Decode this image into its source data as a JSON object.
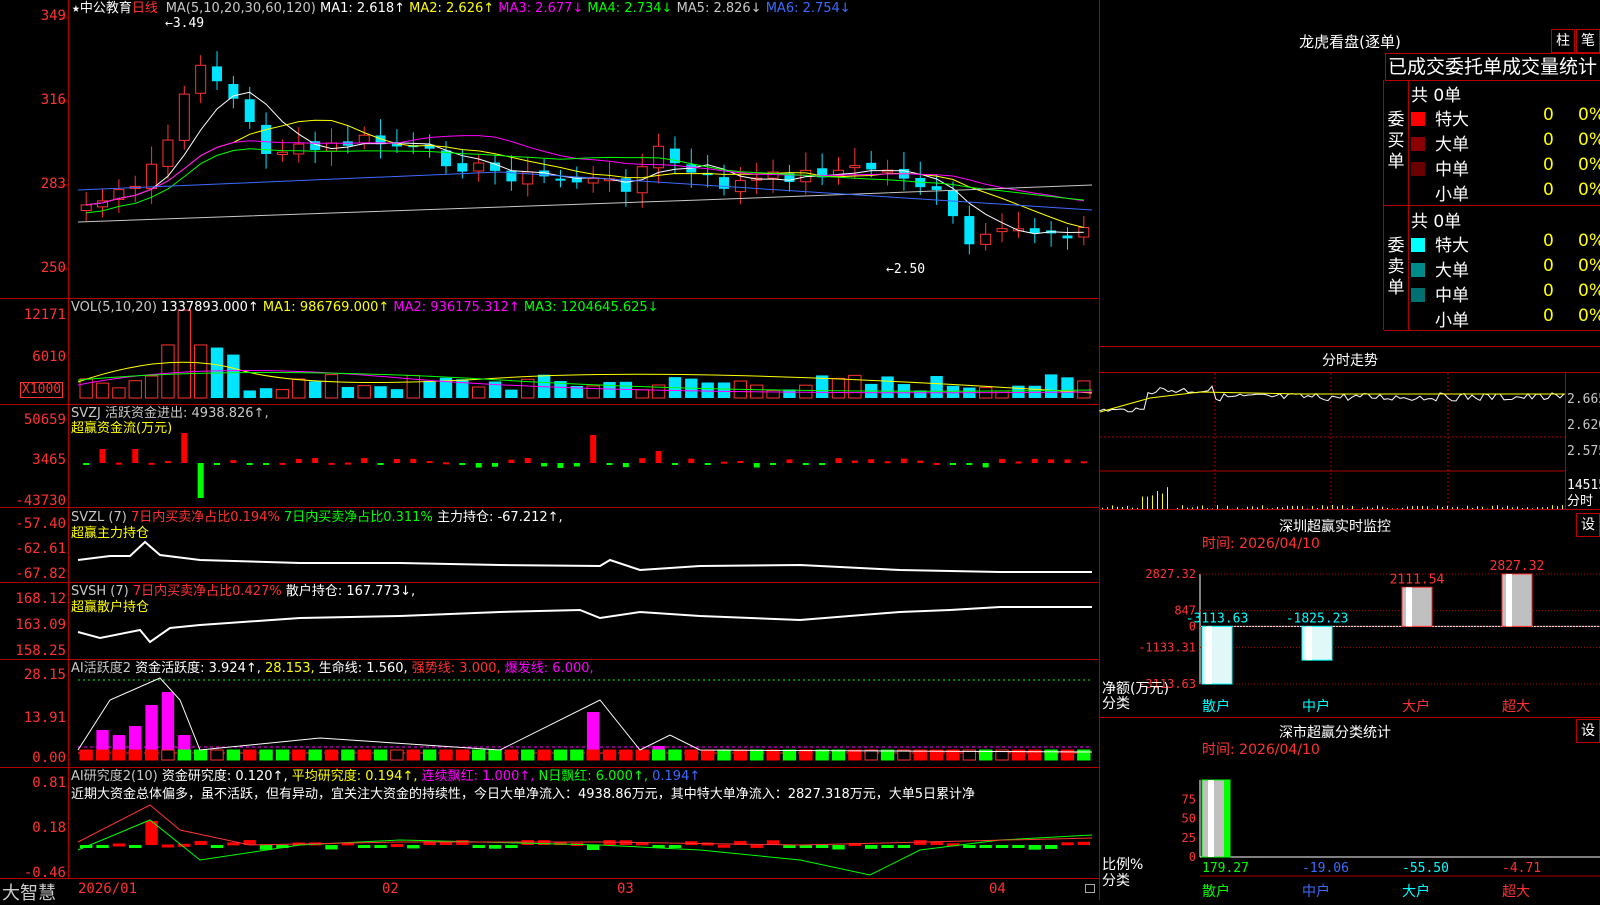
{
  "stock": {
    "name": "中公教育",
    "period": "日线",
    "star": "★"
  },
  "main_panel": {
    "ma_legend": [
      {
        "label": "MA(5,10,20,30,60,120)",
        "color": "#c8c8c8"
      },
      {
        "label": "MA1: 2.618↑",
        "color": "#ffffff"
      },
      {
        "label": "MA2: 2.626↑",
        "color": "#ffff00"
      },
      {
        "label": "MA3: 2.677↓",
        "color": "#ff00ff"
      },
      {
        "label": "MA4: 2.734↓",
        "color": "#00ff00"
      },
      {
        "label": "MA5: 2.826↓",
        "color": "#c8c8c8"
      },
      {
        "label": "MA6: 2.754↓",
        "color": "#3c6bff"
      }
    ],
    "y_ticks": [
      "349",
      "316",
      "283",
      "250"
    ],
    "high_marker": "←3.49",
    "low_marker": "←2.50"
  },
  "vol_panel": {
    "legend": [
      {
        "label": "VOL(5,10,20)",
        "color": "#c8c8c8"
      },
      {
        "label": "1337893.000↑",
        "color": "#ffffff"
      },
      {
        "label": "MA1: 986769.000↑",
        "color": "#ffff00"
      },
      {
        "label": "MA2: 936175.312↑",
        "color": "#ff00ff"
      },
      {
        "label": "MA3: 1204645.625↓",
        "color": "#00ff00"
      }
    ],
    "y_ticks": [
      "12171",
      "6010"
    ],
    "unit": "X1000"
  },
  "svzj_panel": {
    "legend": [
      {
        "label": "SVZJ  活跃资金进出: 4938.826↑,",
        "color": "#c8c8c8"
      }
    ],
    "subtitle": "超赢资金流(万元)",
    "y_ticks": [
      "50659",
      "3465",
      "-43730"
    ]
  },
  "svzl_panel": {
    "legend": [
      {
        "label": "SVZL (7)",
        "color": "#c8c8c8"
      },
      {
        "label": "7日内买卖净占比0.194%",
        "color": "#ff3232"
      },
      {
        "label": "7日内买卖净占比0.311%",
        "color": "#00ff00"
      },
      {
        "label": "主力持仓: -67.212↑,",
        "color": "#ffffff"
      }
    ],
    "subtitle": "超赢主力持仓",
    "y_ticks": [
      "-57.40",
      "-62.61",
      "-67.82"
    ]
  },
  "svsh_panel": {
    "legend": [
      {
        "label": "SVSH (7)",
        "color": "#c8c8c8"
      },
      {
        "label": "7日内买卖净占比0.427%",
        "color": "#ff3232"
      },
      {
        "label": "散户持仓: 167.773↓,",
        "color": "#ffffff"
      }
    ],
    "subtitle": "超赢散户持仓",
    "y_ticks": [
      "168.12",
      "163.09",
      "158.25"
    ]
  },
  "ai_active_panel": {
    "legend": [
      {
        "label": "AI活跃度2",
        "color": "#c8c8c8"
      },
      {
        "label": "资金活跃度: 3.924↑,",
        "color": "#ffffff"
      },
      {
        "label": "28.153,",
        "color": "#ffff00"
      },
      {
        "label": "生命线: 1.560,",
        "color": "#ffffff"
      },
      {
        "label": "强势线: 3.000,",
        "color": "#ff3232"
      },
      {
        "label": "爆发线: 6.000,",
        "color": "#ff00ff"
      }
    ],
    "y_ticks": [
      "28.15",
      "13.91",
      "0.00"
    ]
  },
  "ai_research_panel": {
    "legend": [
      {
        "label": "AI研究度2(10)",
        "color": "#c8c8c8"
      },
      {
        "label": "资金研究度: 0.120↑,",
        "color": "#ffffff"
      },
      {
        "label": "平均研究度: 0.194↑,",
        "color": "#ffff00"
      },
      {
        "label": "连续飘红: 1.000↑,",
        "color": "#ff00ff"
      },
      {
        "label": "N日飘红: 6.000↑,",
        "color": "#00ff00"
      },
      {
        "label": "0.194↑",
        "color": "#3c6bff"
      }
    ],
    "comment": "近期大资金总体偏多，虽不活跃，但有异动，宜关注大资金的持续性，今日大单净流入：4938.86万元，其中特大单净流入：2827.318万元，大单5日累计净",
    "y_ticks": [
      "0.81",
      "0.18",
      "-0.46"
    ]
  },
  "x_axis": {
    "labels": [
      "2026/01",
      "02",
      "03",
      "04"
    ]
  },
  "brand": "大智慧",
  "right_panel": {
    "dragon_tiger": {
      "title": "龙虎看盘(逐单)",
      "btn_bar": "柱",
      "btn_pen": "笔",
      "header": "已成交委托单成交量统计",
      "buy": {
        "side_label": "委买单",
        "total": "共 0单",
        "rows": [
          {
            "label": "特大",
            "count": "0",
            "pct": "0%",
            "color": "#ff0000"
          },
          {
            "label": "大单",
            "count": "0",
            "pct": "0%",
            "color": "#8b0000"
          },
          {
            "label": "中单",
            "count": "0",
            "pct": "0%",
            "color": "#6b0000"
          },
          {
            "label": "小单",
            "count": "0",
            "pct": "0%",
            "color": "#000000"
          }
        ]
      },
      "sell": {
        "side_label": "委卖单",
        "total": "共 0单",
        "rows": [
          {
            "label": "特大",
            "count": "0",
            "pct": "0%",
            "color": "#00ffff"
          },
          {
            "label": "大单",
            "count": "0",
            "pct": "0%",
            "color": "#008b8b"
          },
          {
            "label": "中单",
            "count": "0",
            "pct": "0%",
            "color": "#007070"
          },
          {
            "label": "小单",
            "count": "0",
            "pct": "0%",
            "color": "#000000"
          }
        ]
      }
    },
    "intraday": {
      "title": "分时走势",
      "price_ticks": [
        "2.665",
        "2.620",
        "2.575"
      ],
      "vol_tick": "14515",
      "vol_unit": "分时"
    },
    "sz_monitor": {
      "title": "深圳超赢实时监控",
      "btn_settings": "设",
      "time_label": "时间: 2026/04/10",
      "y_ticks": [
        "2827.32",
        "847",
        "0",
        "-1133.31",
        "-3113.63"
      ],
      "y_title": "净额(万元)",
      "x_title": "分类",
      "categories": [
        "散户",
        "中户",
        "大户",
        "超大"
      ]
    },
    "sz_classify": {
      "title": "深市超赢分类统计",
      "btn_settings": "设",
      "time_label": "时间: 2026/04/10",
      "y_ticks": [
        "75",
        "50",
        "25",
        "0"
      ],
      "y_title": "比例%",
      "x_title": "分类",
      "categories": [
        "散户",
        "中户",
        "大户",
        "超大"
      ]
    }
  },
  "chart_data": [
    {
      "type": "bar",
      "title": "深圳超赢实时监控",
      "xlabel": "分类",
      "ylabel": "净额(万元)",
      "categories": [
        "散户",
        "中户",
        "大户",
        "超大"
      ],
      "values": [
        -3113.63,
        -1825.23,
        2111.54,
        2827.32
      ],
      "ylim": [
        -3113.63,
        2827.32
      ]
    },
    {
      "type": "bar",
      "title": "深市超赢分类统计",
      "xlabel": "分类",
      "ylabel": "比例%",
      "categories": [
        "散户",
        "中户",
        "大户",
        "超大"
      ],
      "values": [
        179.27,
        -19.06,
        -55.5,
        -4.71
      ],
      "ylim": [
        0,
        75
      ]
    }
  ]
}
